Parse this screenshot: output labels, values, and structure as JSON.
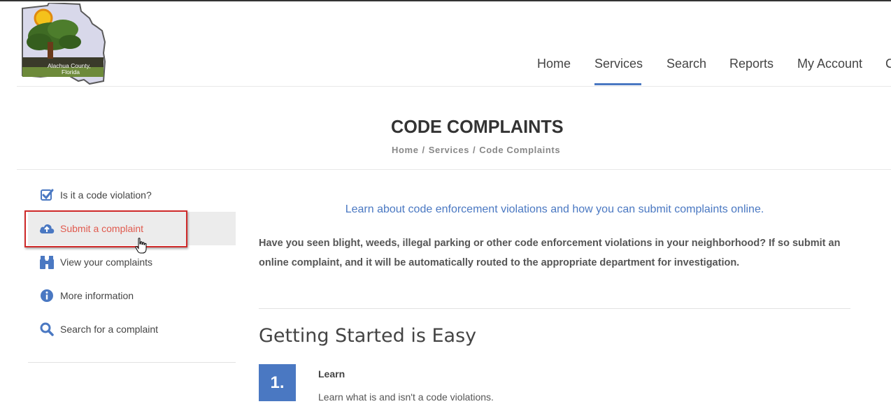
{
  "header": {
    "logo_text": "Alachua County, Florida",
    "nav": [
      {
        "label": "Home"
      },
      {
        "label": "Services"
      },
      {
        "label": "Search"
      },
      {
        "label": "Reports"
      },
      {
        "label": "My Account"
      },
      {
        "label": "C"
      }
    ],
    "active_nav": "Services"
  },
  "page": {
    "title": "CODE COMPLAINTS",
    "breadcrumb": [
      "Home",
      "Services",
      "Code Complaints"
    ]
  },
  "sidebar": {
    "items": [
      {
        "label": "Is it a code violation?",
        "icon": "checkbox-icon"
      },
      {
        "label": "Submit a complaint",
        "icon": "cloud-upload-icon"
      },
      {
        "label": "View your complaints",
        "icon": "binoculars-icon"
      },
      {
        "label": "More information",
        "icon": "info-icon"
      },
      {
        "label": "Search for a complaint",
        "icon": "search-icon"
      }
    ],
    "active": "Submit a complaint"
  },
  "main": {
    "lead": "Learn about code enforcement violations and how you can submit complaints online.",
    "intro": "Have you seen blight, weeds, illegal parking or other code enforcement violations in your neighborhood? If so submit an online complaint, and it will be automatically routed to the appropriate department for investigation.",
    "section_title": "Getting Started is Easy",
    "steps": [
      {
        "number": "1.",
        "title": "Learn",
        "text": "Learn what is and isn't a code violations."
      }
    ]
  },
  "colors": {
    "accent": "#4a78c2",
    "active_link": "#e05a4e",
    "highlight_border": "#cf2a2a"
  }
}
